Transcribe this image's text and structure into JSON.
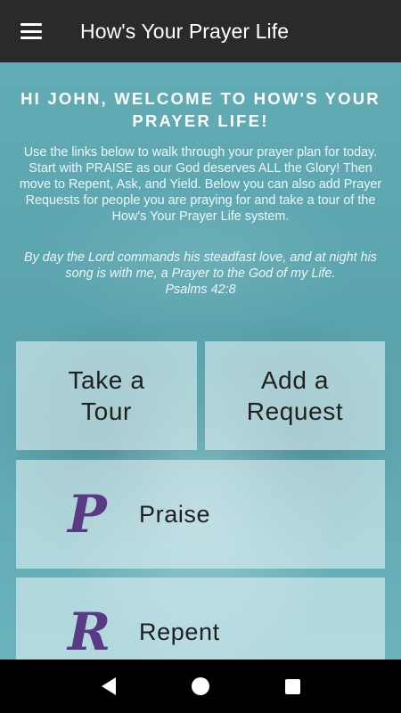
{
  "app_bar": {
    "title": "How's Your Prayer Life",
    "menu_icon": "hamburger-menu-icon"
  },
  "welcome": {
    "heading": "HI JOHN, WELCOME TO HOW'S YOUR PRAYER LIFE!",
    "intro": "Use the links below to walk through your prayer plan for today. Start with PRAISE as our God deserves ALL the Glory! Then move to Repent, Ask, and Yield. Below you can also add Prayer Requests for people you are praying for and take a tour of the How's Your Prayer Life system.",
    "verse": "By day the Lord commands his steadfast love, and at night his song is with me, a Prayer to the God of my Life.",
    "verse_ref": "Psalms 42:8"
  },
  "tiles": {
    "tour": {
      "line1": "Take a",
      "line2": "Tour"
    },
    "request": {
      "line1": "Add a",
      "line2": "Request"
    },
    "praise": {
      "letter": "P",
      "label": "Praise"
    },
    "repent": {
      "letter": "R",
      "label": "Repent"
    }
  },
  "nav_bar": {
    "back_icon": "back-triangle-icon",
    "home_icon": "home-circle-icon",
    "recents_icon": "recents-square-icon"
  },
  "colors": {
    "app_bar": "#2a2a2a",
    "background": "#5fa9b3",
    "tile": "#def1f4",
    "letter_accent": "#5b3a85",
    "nav_bar": "#000000"
  }
}
